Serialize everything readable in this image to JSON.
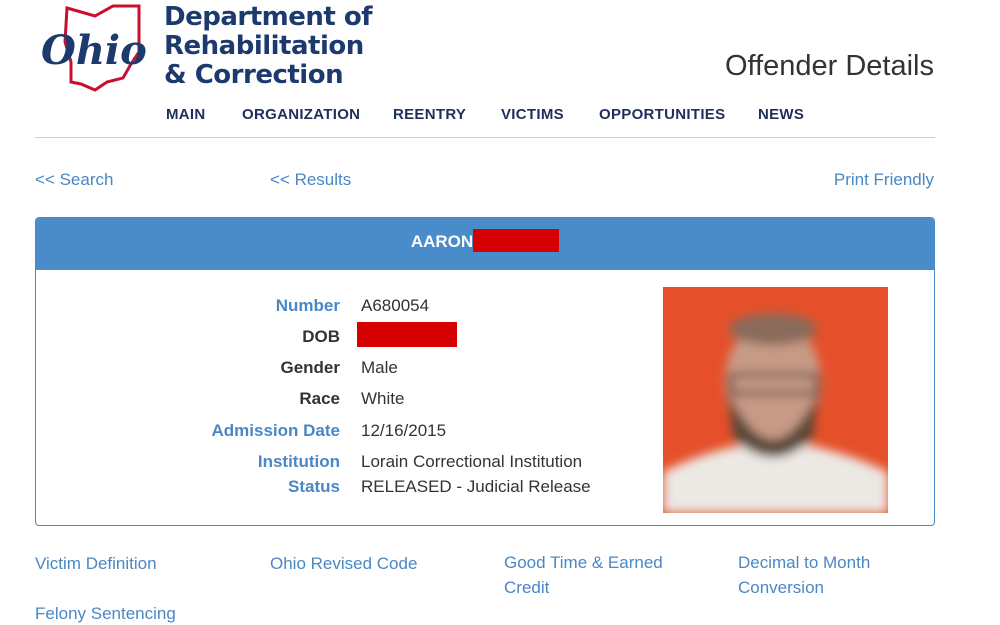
{
  "header": {
    "logo_wordmark": "Ohio",
    "logo_text": [
      "Department of",
      "Rehabilitation",
      "& Correction"
    ],
    "page_title": "Offender Details"
  },
  "nav": [
    "MAIN",
    "ORGANIZATION",
    "REENTRY",
    "VICTIMS",
    "OPPORTUNITIES",
    "NEWS"
  ],
  "links": {
    "search": "<< Search",
    "results": "<< Results",
    "print": "Print Friendly"
  },
  "offender": {
    "name": "AARON",
    "number_label": "Number",
    "number": "A680054",
    "dob_label": "DOB",
    "gender_label": "Gender",
    "gender": "Male",
    "race_label": "Race",
    "race": "White",
    "admission_label": "Admission Date",
    "admission": "12/16/2015",
    "institution_label": "Institution",
    "institution": "Lorain Correctional Institution",
    "status_label": "Status",
    "status": "RELEASED - Judicial Release"
  },
  "footer_links": [
    "Victim Definition",
    "Ohio Revised Code",
    "Good Time & Earned Credit",
    "Decimal to Month Conversion",
    "Felony Sentencing"
  ],
  "colors": {
    "link": "#4a87c5",
    "panel": "#4a8bc9",
    "navy": "#1d3a6e",
    "redaction": "#d60000"
  }
}
